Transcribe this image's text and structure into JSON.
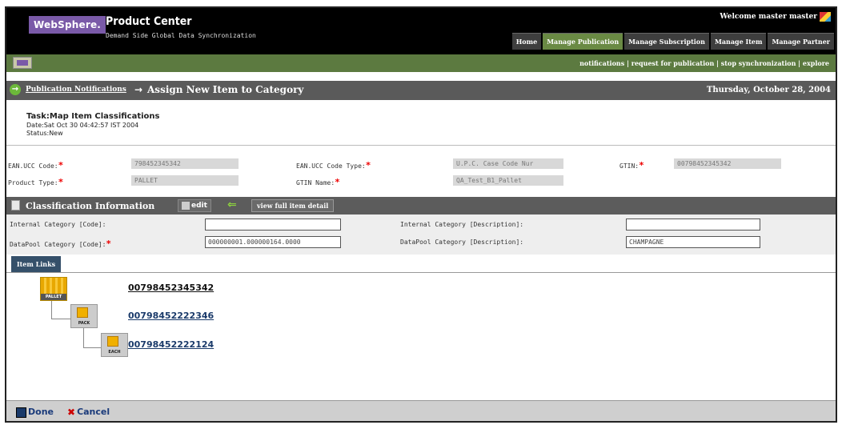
{
  "header": {
    "brand": "WebSphere.",
    "app_name": "Product Center",
    "subtitle": "Demand Side Global Data Synchronization",
    "welcome": "Welcome master master",
    "tabs": [
      {
        "label": "Home"
      },
      {
        "label": "Manage Publication"
      },
      {
        "label": "Manage Subscription"
      },
      {
        "label": "Manage Item"
      },
      {
        "label": "Manage Partner"
      }
    ]
  },
  "subnav": {
    "links": "notifications | request for publication | stop synchronization | explore"
  },
  "breadcrumb": {
    "link": "Publication Notifications",
    "separator": "→",
    "title": "Assign New Item to Category",
    "date": "Thursday, October 28, 2004"
  },
  "task": {
    "name": "Task:Map Item Classifications",
    "date": "Date:Sat Oct 30 04:42:57 IST 2004",
    "status": "Status:New"
  },
  "properties": {
    "ean_label": "EAN.UCC Code:",
    "ean_value": "798452345342",
    "ean_type_label": "EAN.UCC Code Type:",
    "ean_type_value": "U.P.C. Case Code Nur",
    "gtin_label": "GTIN:",
    "gtin_value": "00798452345342",
    "product_type_label": "Product Type:",
    "product_type_value": "PALLET",
    "gtin_name_label": "GTIN Name:",
    "gtin_name_value": "QA_Test_B1_Pallet"
  },
  "classification": {
    "title": "Classification Information",
    "edit_label": "edit",
    "view_label": "view full item detail",
    "internal_code_label": "Internal Category [Code]:",
    "internal_code_value": "",
    "internal_desc_label": "Internal Category [Description]:",
    "internal_desc_value": "",
    "datapool_code_label": "DataPool Category [Code]:",
    "datapool_code_value": "000000001.000000164.0000",
    "datapool_desc_label": "DataPool Category [Description]:",
    "datapool_desc_value": "CHAMPAGNE"
  },
  "item_links": {
    "tab_label": "Item Links",
    "nodes": [
      {
        "label": "PALLET",
        "gtin": "00798452345342"
      },
      {
        "label": "PACK",
        "gtin": "00798452222346"
      },
      {
        "label": "EACH",
        "gtin": "00798452222124"
      }
    ]
  },
  "footer": {
    "done_label": "Done",
    "cancel_label": "Cancel"
  }
}
